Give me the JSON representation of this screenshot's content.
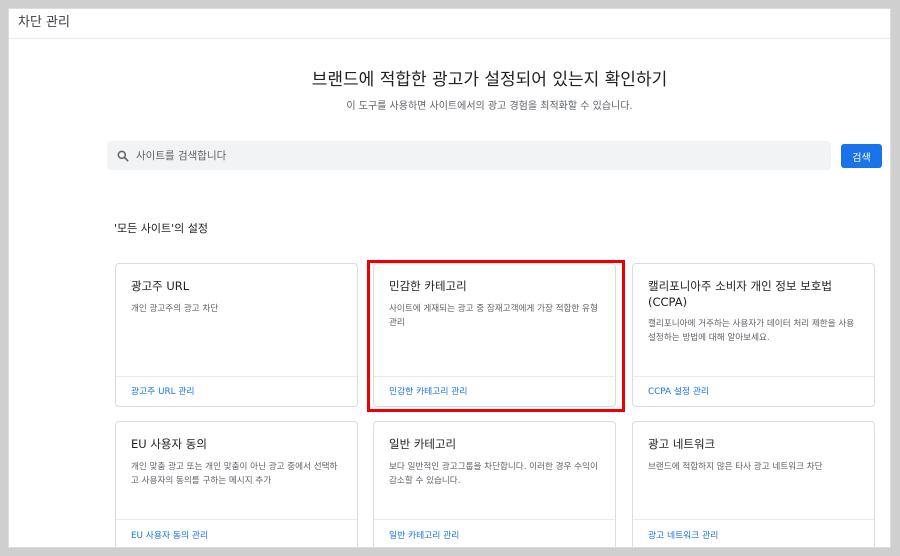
{
  "header": {
    "title": "차단 관리"
  },
  "hero": {
    "title": "브랜드에 적합한 광고가 설정되어 있는지 확인하기",
    "subtitle": "이 도구를 사용하면 사이트에서의 광고 경험을 최적화할 수 있습니다."
  },
  "search": {
    "placeholder": "사이트를 검색합니다",
    "button_label": "검색",
    "icon": "search-icon"
  },
  "section": {
    "label": "'모든 사이트'의 설정"
  },
  "cards": [
    {
      "title": "광고주 URL",
      "description": "개인 광고주의 광고 차단",
      "link": "광고주 URL 관리"
    },
    {
      "title": "민감한 카테고리",
      "description": "사이트에 게재되는 광고 중 잠재고객에게 가장 적합한 유형 관리",
      "link": "민감한 카테고리 관리"
    },
    {
      "title": "캘리포니아주 소비자 개인 정보 보호법 (CCPA)",
      "description": "캘리포니아에 거주하는 사용자가 데이터 처리 제한을 사용 설정하는 방법에 대해 알아보세요.",
      "link": "CCPA 설정 관리"
    },
    {
      "title": "EU 사용자 동의",
      "description": "개인 맞춤 광고 또는 개인 맞춤이 아닌 광고 중에서 선택하고 사용자의 동의를 구하는 메시지 추가",
      "link": "EU 사용자 동의 관리"
    },
    {
      "title": "일반 카테고리",
      "description": "보다 일반적인 광고그룹을 차단합니다. 이러한 경우 수익이 감소할 수 있습니다.",
      "link": "일반 카테고리 관리"
    },
    {
      "title": "광고 네트워크",
      "description": "브랜드에 적합하지 않은 타사 광고 네트워크 차단",
      "link": "광고 네트워크 관리"
    }
  ],
  "colors": {
    "accent": "#1a73e8",
    "highlight": "#ee0000"
  }
}
